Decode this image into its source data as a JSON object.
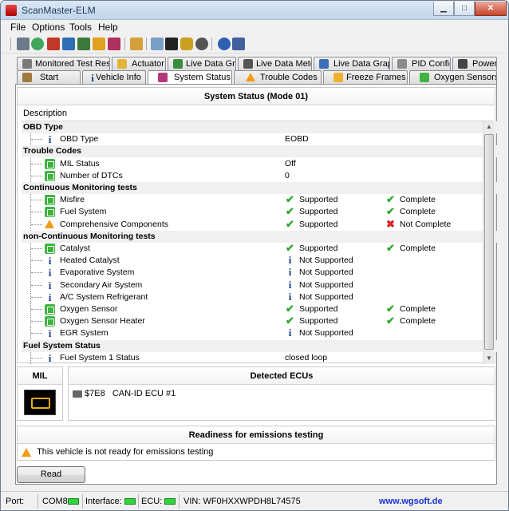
{
  "window": {
    "title": "ScanMaster-ELM",
    "min": "▁",
    "max": "□",
    "close": "✕"
  },
  "menu": [
    "File",
    "Options",
    "Tools",
    "Help"
  ],
  "tabs_top": [
    {
      "label": "Monitored Test Results",
      "icon": "gauge-icon",
      "color": "#7a7a7a"
    },
    {
      "label": "Actuator",
      "icon": "hand-icon",
      "color": "#e3b33a"
    },
    {
      "label": "Live Data Grid",
      "icon": "grid-icon",
      "color": "#3a8c3a"
    },
    {
      "label": "Live Data Meter",
      "icon": "meter-icon",
      "color": "#555555"
    },
    {
      "label": "Live Data Graph",
      "icon": "graph-icon",
      "color": "#3a6fb5"
    },
    {
      "label": "PID Config",
      "icon": "config-icon",
      "color": "#8a8a8a"
    },
    {
      "label": "Power",
      "icon": "car-icon",
      "color": "#444444"
    }
  ],
  "tabs_bottom": [
    {
      "label": "Start",
      "icon": "start-icon",
      "color": "#a07a3a"
    },
    {
      "label": "Vehicle Info",
      "icon": "info-icon",
      "color": "#1a3c8b"
    },
    {
      "label": "System Status",
      "icon": "status-icon",
      "color": "#b5387a"
    },
    {
      "label": "Trouble Codes",
      "icon": "warning-icon",
      "color": "#f39c12"
    },
    {
      "label": "Freeze Frames",
      "icon": "snowflake-icon",
      "color": "#f0b030"
    },
    {
      "label": "Oxygen Sensors",
      "icon": "sensor-icon",
      "color": "#3fb43f"
    }
  ],
  "system_status": {
    "title": "System Status (Mode 01)",
    "column_header": "Description",
    "rows": [
      {
        "type": "cat",
        "label": "OBD Type"
      },
      {
        "type": "item",
        "icon": "info",
        "label": "OBD Type",
        "c2": "EOBD",
        "c2icon": "",
        "c3": "",
        "c3icon": ""
      },
      {
        "type": "cat",
        "label": "Trouble Codes"
      },
      {
        "type": "item",
        "icon": "green",
        "label": "MIL Status",
        "c2": "Off",
        "c2icon": "",
        "c3": "",
        "c3icon": ""
      },
      {
        "type": "item",
        "icon": "green",
        "label": "Number of DTCs",
        "c2": "0",
        "c2icon": "",
        "c3": "",
        "c3icon": ""
      },
      {
        "type": "cat",
        "label": "Continuous Monitoring tests"
      },
      {
        "type": "item",
        "icon": "green",
        "label": "Misfire",
        "c2": "Supported",
        "c2icon": "check",
        "c3": "Complete",
        "c3icon": "check"
      },
      {
        "type": "item",
        "icon": "green",
        "label": "Fuel System",
        "c2": "Supported",
        "c2icon": "check",
        "c3": "Complete",
        "c3icon": "check"
      },
      {
        "type": "item",
        "icon": "warn",
        "label": "Comprehensive Components",
        "c2": "Supported",
        "c2icon": "check",
        "c3": "Not Complete",
        "c3icon": "cross"
      },
      {
        "type": "cat",
        "label": "non-Continuous Monitoring tests"
      },
      {
        "type": "item",
        "icon": "green",
        "label": "Catalyst",
        "c2": "Supported",
        "c2icon": "check",
        "c3": "Complete",
        "c3icon": "check"
      },
      {
        "type": "item",
        "icon": "info",
        "label": "Heated Catalyst",
        "c2": "Not Supported",
        "c2icon": "info",
        "c3": "",
        "c3icon": ""
      },
      {
        "type": "item",
        "icon": "info",
        "label": "Evaporative System",
        "c2": "Not Supported",
        "c2icon": "info",
        "c3": "",
        "c3icon": ""
      },
      {
        "type": "item",
        "icon": "info",
        "label": "Secondary Air System",
        "c2": "Not Supported",
        "c2icon": "info",
        "c3": "",
        "c3icon": ""
      },
      {
        "type": "item",
        "icon": "info",
        "label": "A/C System Refrigerant",
        "c2": "Not Supported",
        "c2icon": "info",
        "c3": "",
        "c3icon": ""
      },
      {
        "type": "item",
        "icon": "green",
        "label": "Oxygen Sensor",
        "c2": "Supported",
        "c2icon": "check",
        "c3": "Complete",
        "c3icon": "check"
      },
      {
        "type": "item",
        "icon": "green",
        "label": "Oxygen Sensor Heater",
        "c2": "Supported",
        "c2icon": "check",
        "c3": "Complete",
        "c3icon": "check"
      },
      {
        "type": "item",
        "icon": "info",
        "label": "EGR System",
        "c2": "Not Supported",
        "c2icon": "info",
        "c3": "",
        "c3icon": ""
      },
      {
        "type": "cat",
        "label": "Fuel System Status"
      },
      {
        "type": "item",
        "icon": "info",
        "label": "Fuel System 1 Status",
        "c2": "closed loop",
        "c2icon": "",
        "c3": "",
        "c3icon": ""
      }
    ]
  },
  "mil": {
    "title": "MIL"
  },
  "ecus": {
    "title": "Detected ECUs",
    "items": [
      {
        "id": "$7E8",
        "name": "CAN-ID ECU #1"
      }
    ]
  },
  "readiness": {
    "title": "Readiness for emissions testing",
    "message": "This vehicle is not ready for emissions testing"
  },
  "read_button": "Read",
  "status_bar": {
    "port_label": "Port:",
    "com": "COM8",
    "interface_label": "Interface:",
    "ecu_label": "ECU:",
    "vin": "VIN: WF0HXXWPDH8L74575",
    "website": "www.wgsoft.de"
  },
  "colors": {
    "accent": "#1a3c8b",
    "ok": "#2eaa2e",
    "error": "#d22222",
    "warning": "#f39c12",
    "led": "#31d63a"
  }
}
